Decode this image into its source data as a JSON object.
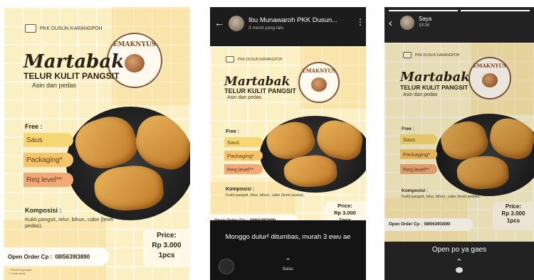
{
  "poster": {
    "org": "PKK DUSUN KARANGPOH",
    "title": "Martabak",
    "subtitle": "TELUR KULIT PANGSIT",
    "tagline": "Asin dan pedas",
    "logo_text": "EMAKNYUS",
    "free_label": "Free :",
    "free_items": [
      "Saus",
      "Packaging*",
      "Req level**"
    ],
    "komposisi_label": "Komposisi :",
    "komposisi_text": "Kukit pangsit, telur, bihun, cabe (level pedas).",
    "price_label": "Price:",
    "price_value": "Rp 3.000",
    "price_unit": "1pcs",
    "order_label": "Open Order Cp :",
    "order_phone": "08I5639I3890",
    "legend": [
      "* Ramah lingkungan",
      "** Level pedas"
    ]
  },
  "whatsapp": {
    "contact_name": "Ibu Munawaroh PKK Dusun...",
    "time": "3 menit yang lalu",
    "caption": "Monggo dulur² ditumbas, murah 3 ewu ae",
    "reply_label": "Balas"
  },
  "instagram": {
    "user": "Saya",
    "time": "19.34",
    "caption": "Open po ya gaes"
  }
}
